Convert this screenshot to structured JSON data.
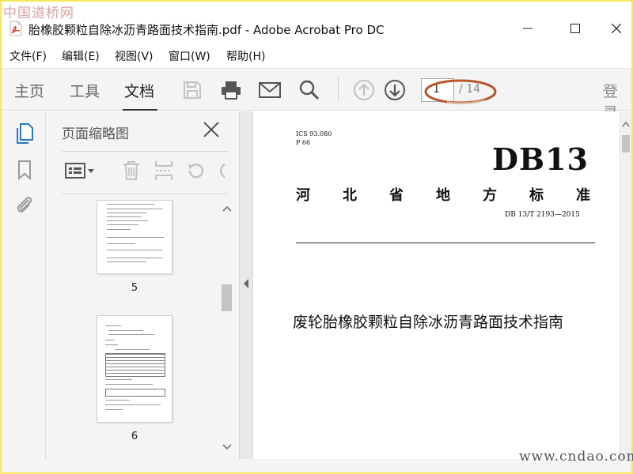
{
  "watermarks": {
    "top_left": "中国道桥网",
    "bottom_right": "www.cndao.com"
  },
  "window": {
    "title": "胎橡胶颗粒自除冰沥青路面技术指南.pdf - Adobe Acrobat Pro DC"
  },
  "menu": [
    "文件(F)",
    "编辑(E)",
    "视图(V)",
    "窗口(W)",
    "帮助(H)"
  ],
  "nav_tabs": [
    "主页",
    "工具",
    "文档"
  ],
  "toolbar_icons": [
    "save-icon",
    "print-icon",
    "email-icon",
    "search-icon",
    "page-up-icon",
    "page-down-icon"
  ],
  "page_nav": {
    "current": "1",
    "total": "/ 14"
  },
  "login_label": "登录",
  "colors": {
    "highlight_ellipse": "#b8562a",
    "watermark_top": "#d9a2a2",
    "accent_blue": "#2a78c6"
  },
  "left_rail_icons": [
    "page-thumbnails-icon",
    "bookmark-icon",
    "attachment-icon"
  ],
  "thumbnail_panel": {
    "title": "页面缩略图",
    "tool_icons": [
      "options-menu-icon",
      "delete-icon",
      "insert-page-icon",
      "rotate-left-icon",
      "rotate-right-icon"
    ],
    "pages": [
      {
        "label": "5"
      },
      {
        "label": "6"
      }
    ]
  },
  "document": {
    "ics": "ICS 93.080",
    "p": "P 66",
    "db": "DB13",
    "province_chars": [
      "河",
      "北",
      "省",
      "地",
      "方",
      "标",
      "准"
    ],
    "std_number": "DB 13/T 2193—2015",
    "heading": "废轮胎橡胶颗粒自除冰沥青路面技术指南"
  }
}
